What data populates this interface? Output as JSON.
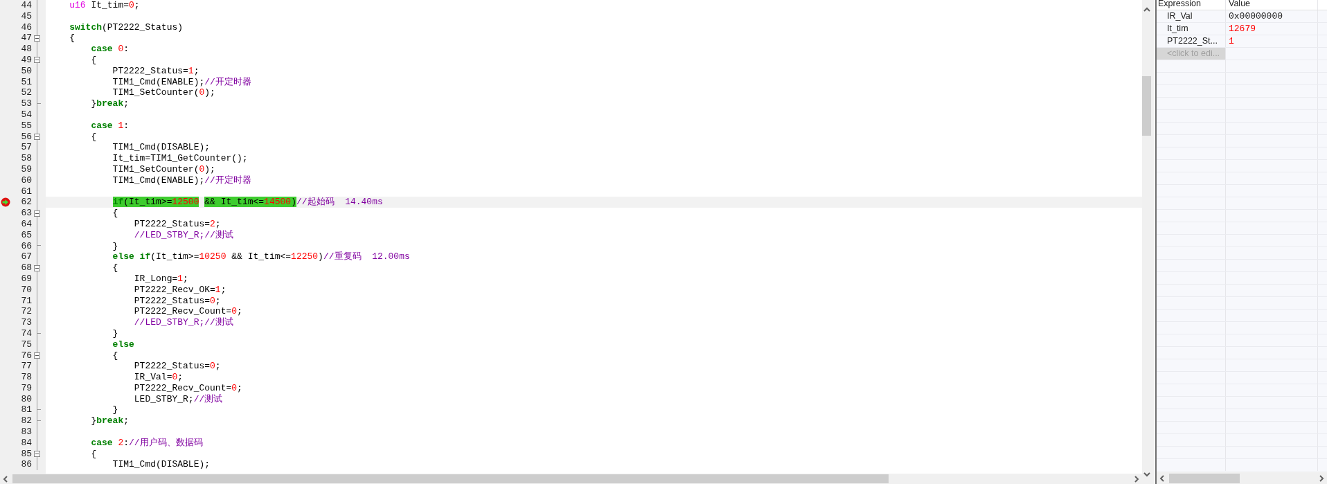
{
  "editor": {
    "lines": [
      {
        "number": "44",
        "tokens": [
          {
            "kind": "type",
            "text": "    u16"
          },
          {
            "kind": "plain",
            "text": " It_tim="
          },
          {
            "kind": "number",
            "text": "0"
          },
          {
            "kind": "plain",
            "text": ";"
          }
        ]
      },
      {
        "number": "45"
      },
      {
        "number": "46",
        "tokens": [
          {
            "kind": "keyword",
            "text": "    switch"
          },
          {
            "kind": "plain",
            "text": "(PT2222_Status)"
          }
        ]
      },
      {
        "number": "47",
        "foldable": true,
        "tokens": [
          {
            "kind": "plain",
            "text": "    {"
          }
        ]
      },
      {
        "number": "48",
        "tokens": [
          {
            "kind": "keyword",
            "text": "        case"
          },
          {
            "kind": "number",
            "text": " 0"
          },
          {
            "kind": "plain",
            "text": ":"
          }
        ]
      },
      {
        "number": "49",
        "foldable": true,
        "tokens": [
          {
            "kind": "plain",
            "text": "        {"
          }
        ]
      },
      {
        "number": "50",
        "tokens": [
          {
            "kind": "plain",
            "text": "            PT2222_Status="
          },
          {
            "kind": "number",
            "text": "1"
          },
          {
            "kind": "plain",
            "text": ";"
          }
        ]
      },
      {
        "number": "51",
        "tokens": [
          {
            "kind": "plain",
            "text": "            TIM1_Cmd(ENABLE);"
          },
          {
            "kind": "comment",
            "text": "//开定时器"
          }
        ]
      },
      {
        "number": "52",
        "tokens": [
          {
            "kind": "plain",
            "text": "            TIM1_SetCounter("
          },
          {
            "kind": "number",
            "text": "0"
          },
          {
            "kind": "plain",
            "text": ");"
          }
        ]
      },
      {
        "number": "53",
        "block_end": true,
        "tokens": [
          {
            "kind": "plain",
            "text": "        }"
          },
          {
            "kind": "keyword",
            "text": "break"
          },
          {
            "kind": "plain",
            "text": ";"
          }
        ]
      },
      {
        "number": "54"
      },
      {
        "number": "55",
        "tokens": [
          {
            "kind": "keyword",
            "text": "        case"
          },
          {
            "kind": "number",
            "text": " 1"
          },
          {
            "kind": "plain",
            "text": ":"
          }
        ]
      },
      {
        "number": "56",
        "foldable": true,
        "tokens": [
          {
            "kind": "plain",
            "text": "        {"
          }
        ]
      },
      {
        "number": "57",
        "tokens": [
          {
            "kind": "plain",
            "text": "            TIM1_Cmd(DISABLE);"
          }
        ]
      },
      {
        "number": "58",
        "tokens": [
          {
            "kind": "plain",
            "text": "            It_tim=TIM1_GetCounter();"
          }
        ]
      },
      {
        "number": "59",
        "tokens": [
          {
            "kind": "plain",
            "text": "            TIM1_SetCounter("
          },
          {
            "kind": "number",
            "text": "0"
          },
          {
            "kind": "plain",
            "text": ");"
          }
        ]
      },
      {
        "number": "60",
        "tokens": [
          {
            "kind": "plain",
            "text": "            TIM1_Cmd(ENABLE);"
          },
          {
            "kind": "comment",
            "text": "//开定时器"
          }
        ]
      },
      {
        "number": "61"
      },
      {
        "number": "62",
        "current": true,
        "tokens": [
          {
            "kind": "keyword",
            "text": "            if",
            "selected": true
          },
          {
            "kind": "plain",
            "text": "(It_tim>=",
            "selected": true
          },
          {
            "kind": "number",
            "text": "12500",
            "selected": true
          },
          {
            "kind": "plain",
            "text": " && It_tim<=",
            "selected": true
          },
          {
            "kind": "number",
            "text": "14500",
            "selected": true
          },
          {
            "kind": "plain",
            "text": ")",
            "selected": true
          },
          {
            "kind": "comment",
            "text": "//起始码  14.40ms"
          }
        ]
      },
      {
        "number": "63",
        "foldable": true,
        "tokens": [
          {
            "kind": "plain",
            "text": "            {"
          }
        ]
      },
      {
        "number": "64",
        "tokens": [
          {
            "kind": "plain",
            "text": "                PT2222_Status="
          },
          {
            "kind": "number",
            "text": "2"
          },
          {
            "kind": "plain",
            "text": ";"
          }
        ]
      },
      {
        "number": "65",
        "tokens": [
          {
            "kind": "comment",
            "text": "                //LED_STBY_R;//测试"
          }
        ]
      },
      {
        "number": "66",
        "block_end": true,
        "tokens": [
          {
            "kind": "plain",
            "text": "            }"
          }
        ]
      },
      {
        "number": "67",
        "tokens": [
          {
            "kind": "keyword",
            "text": "            else if"
          },
          {
            "kind": "plain",
            "text": "(It_tim>="
          },
          {
            "kind": "number",
            "text": "10250"
          },
          {
            "kind": "plain",
            "text": " && It_tim<="
          },
          {
            "kind": "number",
            "text": "12250"
          },
          {
            "kind": "plain",
            "text": ")"
          },
          {
            "kind": "comment",
            "text": "//重复码  12.00ms"
          }
        ]
      },
      {
        "number": "68",
        "foldable": true,
        "tokens": [
          {
            "kind": "plain",
            "text": "            {"
          }
        ]
      },
      {
        "number": "69",
        "tokens": [
          {
            "kind": "plain",
            "text": "                IR_Long="
          },
          {
            "kind": "number",
            "text": "1"
          },
          {
            "kind": "plain",
            "text": ";"
          }
        ]
      },
      {
        "number": "70",
        "tokens": [
          {
            "kind": "plain",
            "text": "                PT2222_Recv_OK="
          },
          {
            "kind": "number",
            "text": "1"
          },
          {
            "kind": "plain",
            "text": ";"
          }
        ]
      },
      {
        "number": "71",
        "tokens": [
          {
            "kind": "plain",
            "text": "                PT2222_Status="
          },
          {
            "kind": "number",
            "text": "0"
          },
          {
            "kind": "plain",
            "text": ";"
          }
        ]
      },
      {
        "number": "72",
        "tokens": [
          {
            "kind": "plain",
            "text": "                PT2222_Recv_Count="
          },
          {
            "kind": "number",
            "text": "0"
          },
          {
            "kind": "plain",
            "text": ";"
          }
        ]
      },
      {
        "number": "73",
        "tokens": [
          {
            "kind": "comment",
            "text": "                //LED_STBY_R;//测试"
          }
        ]
      },
      {
        "number": "74",
        "block_end": true,
        "tokens": [
          {
            "kind": "plain",
            "text": "            }"
          }
        ]
      },
      {
        "number": "75",
        "tokens": [
          {
            "kind": "keyword",
            "text": "            else"
          }
        ]
      },
      {
        "number": "76",
        "foldable": true,
        "tokens": [
          {
            "kind": "plain",
            "text": "            {"
          }
        ]
      },
      {
        "number": "77",
        "tokens": [
          {
            "kind": "plain",
            "text": "                PT2222_Status="
          },
          {
            "kind": "number",
            "text": "0"
          },
          {
            "kind": "plain",
            "text": ";"
          }
        ]
      },
      {
        "number": "78",
        "tokens": [
          {
            "kind": "plain",
            "text": "                IR_Val="
          },
          {
            "kind": "number",
            "text": "0"
          },
          {
            "kind": "plain",
            "text": ";"
          }
        ]
      },
      {
        "number": "79",
        "tokens": [
          {
            "kind": "plain",
            "text": "                PT2222_Recv_Count="
          },
          {
            "kind": "number",
            "text": "0"
          },
          {
            "kind": "plain",
            "text": ";"
          }
        ]
      },
      {
        "number": "80",
        "tokens": [
          {
            "kind": "plain",
            "text": "                LED_STBY_R;"
          },
          {
            "kind": "comment",
            "text": "//测试"
          }
        ]
      },
      {
        "number": "81",
        "block_end": true,
        "tokens": [
          {
            "kind": "plain",
            "text": "            }"
          }
        ]
      },
      {
        "number": "82",
        "block_end": true,
        "tokens": [
          {
            "kind": "plain",
            "text": "        }"
          },
          {
            "kind": "keyword",
            "text": "break"
          },
          {
            "kind": "plain",
            "text": ";"
          }
        ]
      },
      {
        "number": "83"
      },
      {
        "number": "84",
        "tokens": [
          {
            "kind": "keyword",
            "text": "        case"
          },
          {
            "kind": "number",
            "text": " 2"
          },
          {
            "kind": "plain",
            "text": ":"
          },
          {
            "kind": "comment",
            "text": "//用户码、数据码"
          }
        ]
      },
      {
        "number": "85",
        "foldable": true,
        "tokens": [
          {
            "kind": "plain",
            "text": "        {"
          }
        ]
      },
      {
        "number": "86",
        "tokens": [
          {
            "kind": "plain",
            "text": "            TIM1_Cmd(DISABLE);"
          }
        ]
      }
    ]
  },
  "watch": {
    "columns": [
      "Expression",
      "Value"
    ],
    "rows": [
      {
        "expression": "IR_Val",
        "value": "0x00000000",
        "changed": false
      },
      {
        "expression": "It_tim",
        "value": "12679",
        "changed": true
      },
      {
        "expression": "PT2222_St...",
        "value": "1",
        "changed": true
      }
    ],
    "placeholder": "<click to edi..."
  }
}
